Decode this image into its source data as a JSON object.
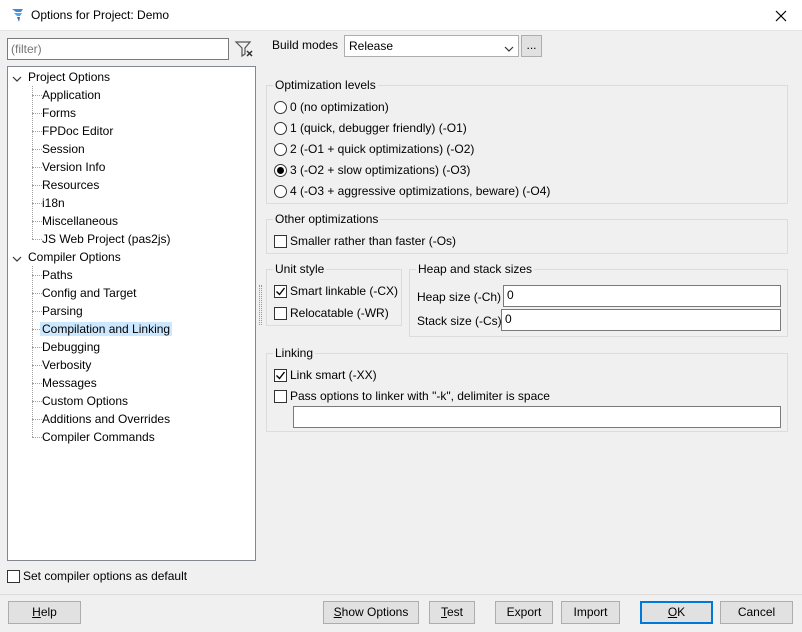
{
  "window": {
    "title": "Options for Project: Demo"
  },
  "filter": {
    "placeholder": "(filter)"
  },
  "tree": {
    "project_options": "Project Options",
    "project_children": [
      "Application",
      "Forms",
      "FPDoc Editor",
      "Session",
      "Version Info",
      "Resources",
      "i18n",
      "Miscellaneous",
      "JS Web Project (pas2js)"
    ],
    "compiler_options": "Compiler Options",
    "compiler_children": [
      "Paths",
      "Config and Target",
      "Parsing",
      "Compilation and Linking",
      "Debugging",
      "Verbosity",
      "Messages",
      "Custom Options",
      "Additions and Overrides",
      "Compiler Commands"
    ],
    "selected": "Compilation and Linking"
  },
  "build_modes": {
    "label": "Build modes",
    "value": "Release",
    "more": "..."
  },
  "optimization": {
    "title": "Optimization levels",
    "options": [
      "0 (no optimization)",
      "1 (quick, debugger friendly) (-O1)",
      "2 (-O1 + quick optimizations) (-O2)",
      "3 (-O2 + slow optimizations) (-O3)",
      "4 (-O3 + aggressive optimizations, beware) (-O4)"
    ],
    "selected_index": 3
  },
  "other_opt": {
    "title": "Other optimizations",
    "smaller": "Smaller rather than faster (-Os)",
    "smaller_checked": false
  },
  "unit_style": {
    "title": "Unit style",
    "smart": "Smart linkable (-CX)",
    "smart_checked": true,
    "reloc": "Relocatable (-WR)",
    "reloc_checked": false
  },
  "heap": {
    "title": "Heap and stack sizes",
    "heap_label": "Heap size (-Ch)",
    "heap_value": "0",
    "stack_label": "Stack size (-Cs)",
    "stack_value": "0"
  },
  "linking": {
    "title": "Linking",
    "link_smart": "Link smart (-XX)",
    "link_smart_checked": true,
    "pass_opts": "Pass options to linker with \"-k\", delimiter is space",
    "pass_opts_checked": false,
    "linker_value": ""
  },
  "default_cb": {
    "label": "Set compiler options as default",
    "checked": false
  },
  "buttons": {
    "help_u": "H",
    "help_rest": "elp",
    "show_u": "S",
    "show_rest": "how Options",
    "test_u": "T",
    "test_rest": "est",
    "export": "Export",
    "import": "Import",
    "ok_u": "O",
    "ok_rest": "K",
    "cancel": "Cancel"
  },
  "colors": {
    "selection": "#cce8ff",
    "default_button": "#0078d7",
    "app_icon": "#3c8ad8"
  }
}
